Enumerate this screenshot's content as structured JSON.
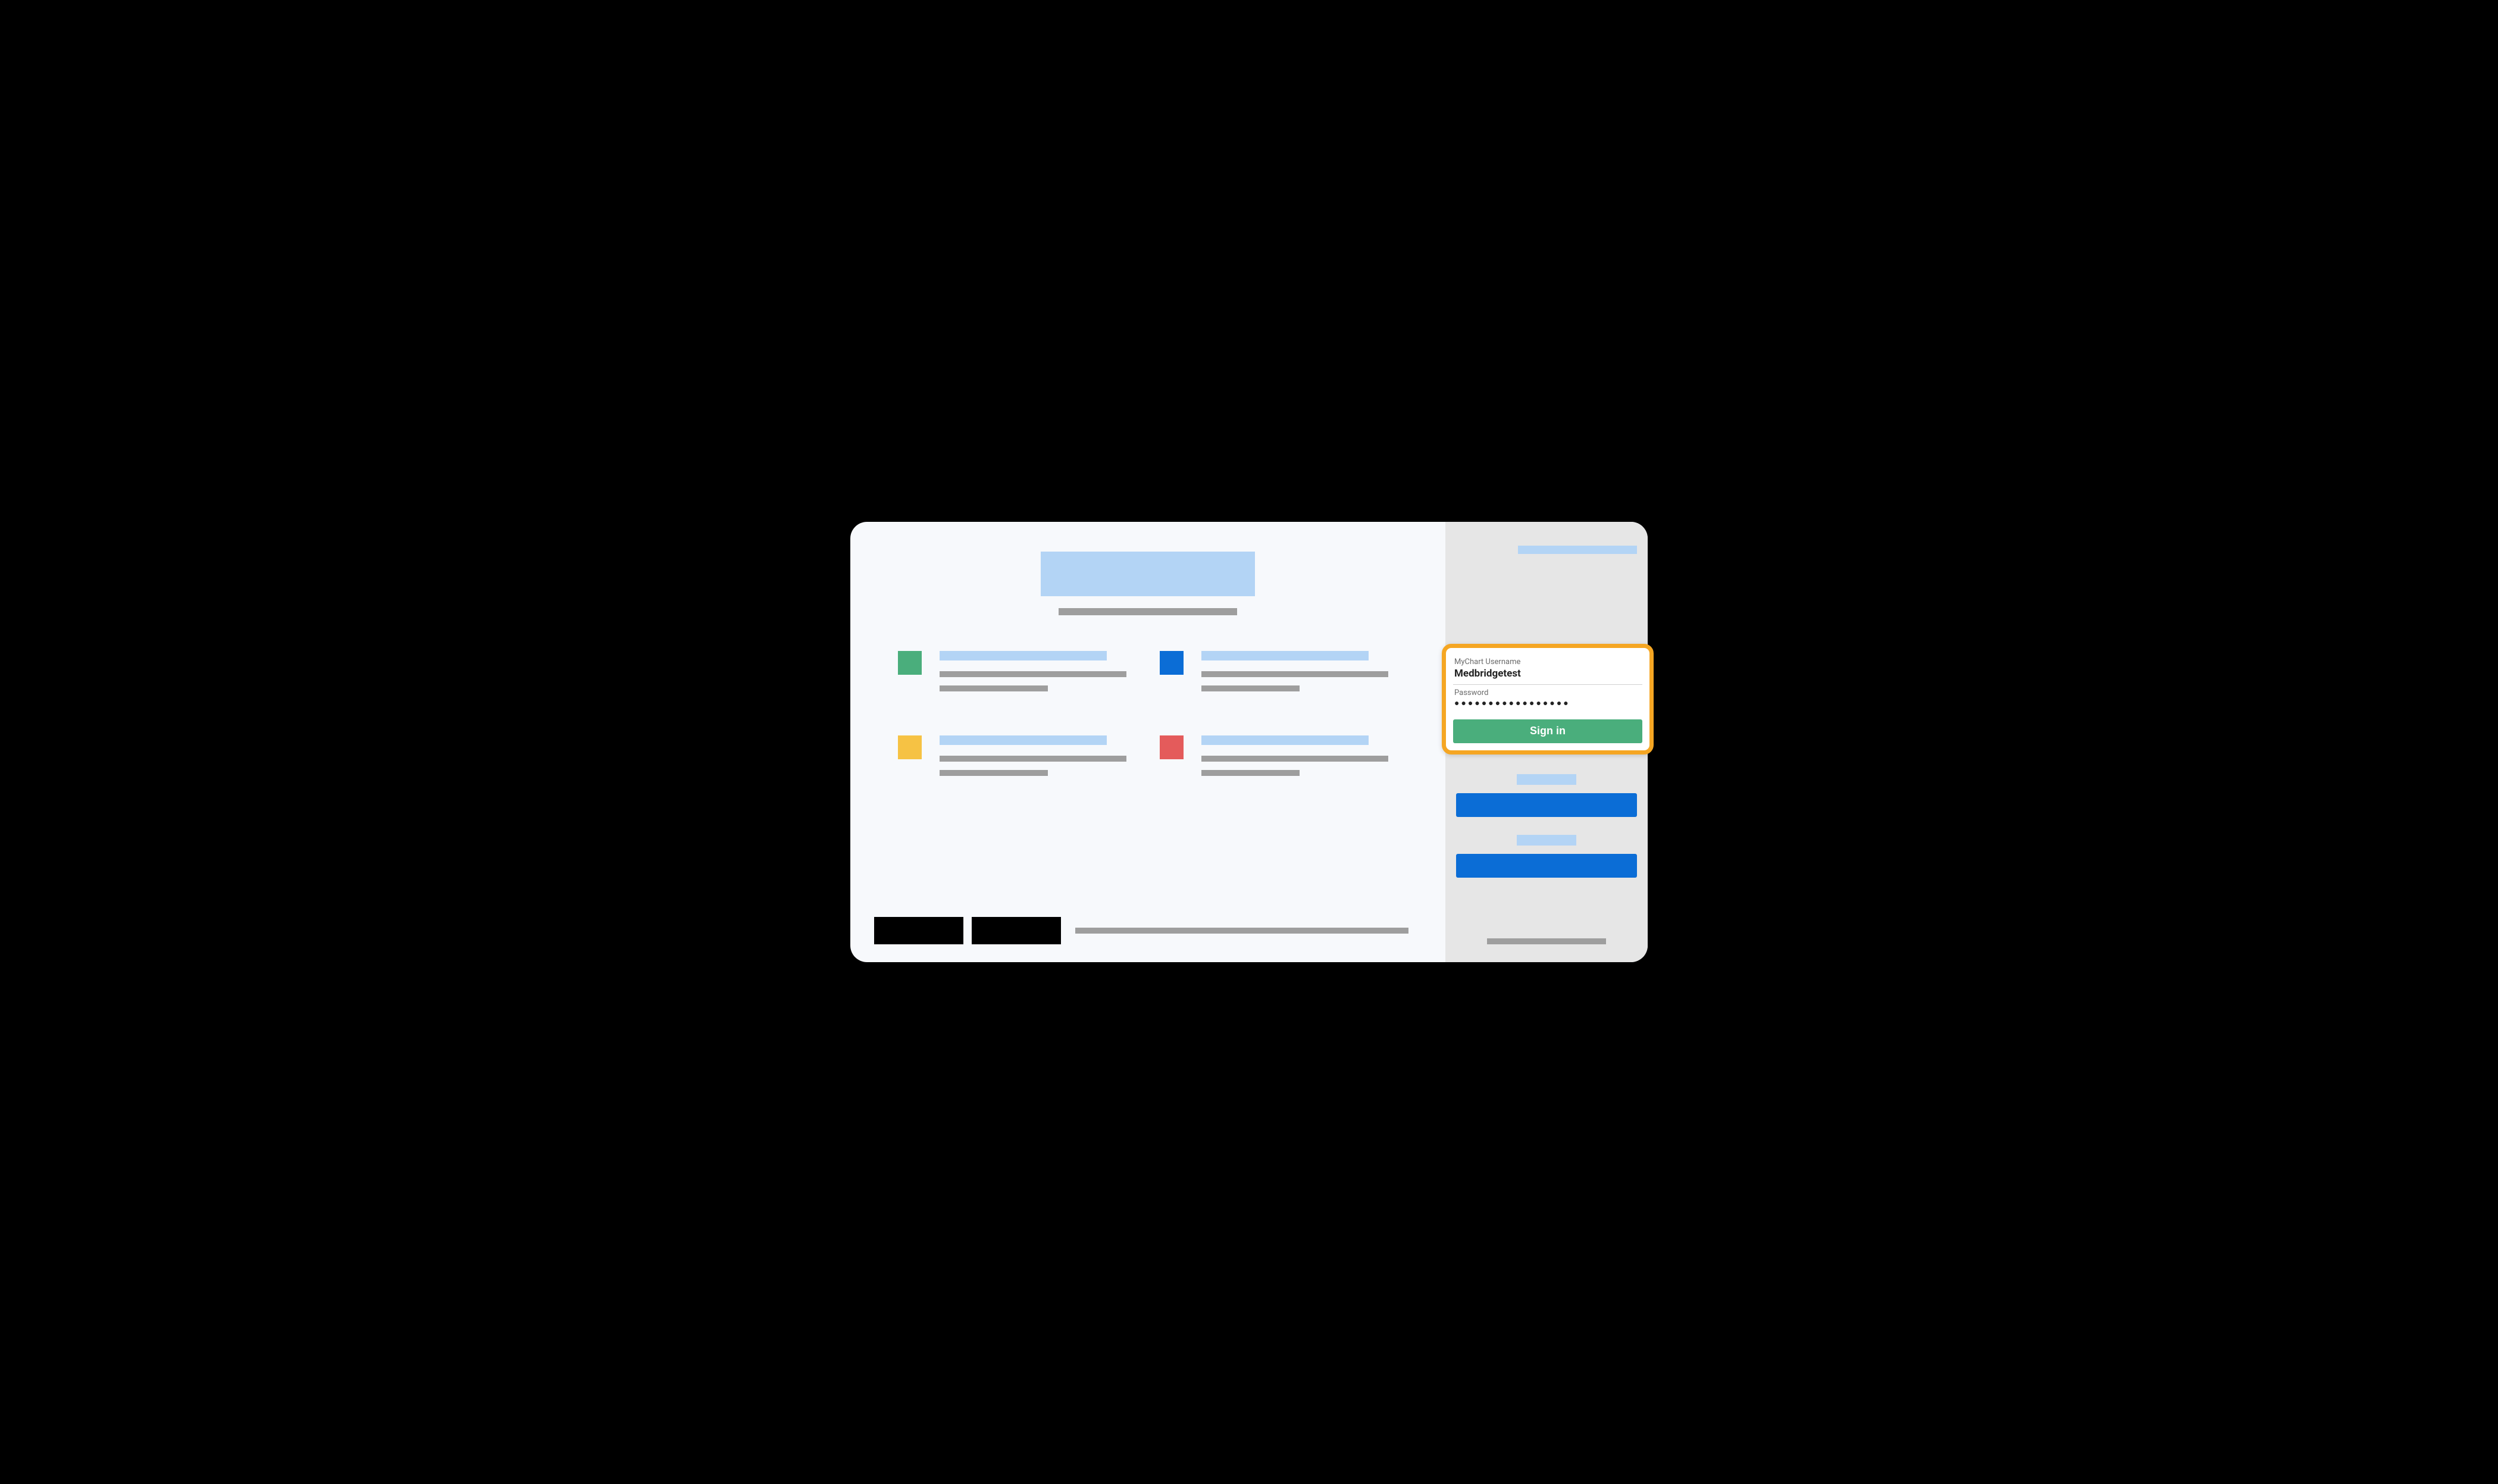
{
  "login": {
    "username_label": "MyChart Username",
    "username_value": "Medbridgetest",
    "password_label": "Password",
    "password_mask": "●●●●●●●●●●●●●●●●●",
    "signin_label": "Sign in"
  },
  "tiles": [
    {
      "color": "green"
    },
    {
      "color": "blue"
    },
    {
      "color": "yellow"
    },
    {
      "color": "red"
    }
  ],
  "colors": {
    "accent_blue": "#0b6dd6",
    "light_blue": "#b3d4f5",
    "green": "#4aae7c",
    "yellow": "#f6c244",
    "red": "#e45b5b",
    "highlight": "#f5a623"
  }
}
